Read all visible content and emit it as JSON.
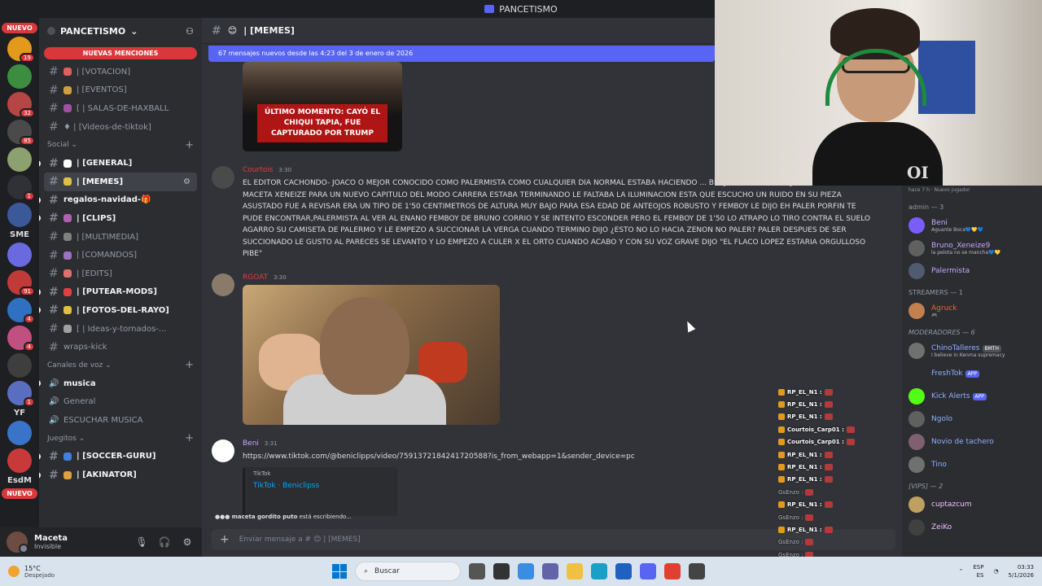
{
  "window": {
    "title": "PANCETISMO"
  },
  "rail": {
    "nuevo_top": "NUEVO",
    "nuevo_bottom": "NUEVO",
    "servers": [
      {
        "color": "#e39a1c",
        "badge": "19"
      },
      {
        "color": "#3c8d40",
        "badge": ""
      },
      {
        "color": "#b64545",
        "badge": "32"
      },
      {
        "color": "#4a4a4a",
        "badge": "85"
      },
      {
        "color": "#8da070",
        "badge": ""
      },
      {
        "color": "#2f3136",
        "badge": "1"
      },
      {
        "color": "#3b5998",
        "badge": ""
      }
    ],
    "text_sme": "SME",
    "servers2": [
      {
        "color": "#6a6ae0",
        "badge": ""
      },
      {
        "color": "#c03a3a",
        "badge": "91"
      },
      {
        "color": "#3070c0",
        "badge": "4"
      },
      {
        "color": "#c05080",
        "badge": "4"
      },
      {
        "color": "#3e3e3e",
        "badge": ""
      },
      {
        "color": "#5a6ec0",
        "badge": "1"
      }
    ],
    "text_yf": "YF",
    "servers3": [
      {
        "color": "#3a74c8",
        "badge": ""
      },
      {
        "color": "#c83a3a",
        "badge": ""
      }
    ],
    "text_esdm": "EsdM"
  },
  "guild": {
    "name": "PANCETISMO",
    "mentions_label": "NUEVAS MENCIONES"
  },
  "channels_top": [
    {
      "name": "| [VOTACION]",
      "emo": "#e06060"
    },
    {
      "name": "| [EVENTOS]",
      "emo": "#d0a040"
    },
    {
      "name": "[ | SALAS-DE-HAXBALL",
      "emo": "#a050a0"
    },
    {
      "name": "♦ | [Videos-de-tiktok]",
      "emo": ""
    }
  ],
  "cat_social": "Social",
  "channels_social": [
    {
      "name": "| [GENERAL]",
      "emo": "#ffffff",
      "bold": true
    },
    {
      "name": "| [MEMES]",
      "emo": "#e0c040",
      "bold": true,
      "active": true
    },
    {
      "name": "regalos-navidad-🎁",
      "emo": "",
      "bold": true
    },
    {
      "name": "| [CLIPS]",
      "emo": "#b060b0",
      "bold": true
    },
    {
      "name": "| [MULTIMEDIA]",
      "emo": "#808080",
      "bold": false
    },
    {
      "name": "| [COMANDOS]",
      "emo": "#a070c0",
      "bold": false
    },
    {
      "name": "| [EDITS]",
      "emo": "#e07070",
      "bold": false
    },
    {
      "name": "| [PUTEAR-MODS]",
      "emo": "#e04040",
      "bold": true
    },
    {
      "name": "| [FOTOS-DEL-RAYO]",
      "emo": "#e0c040",
      "bold": true
    },
    {
      "name": "[ | Ideas-y-tornados-...",
      "emo": "#a0a0a0",
      "bold": false
    },
    {
      "name": "wraps-kick",
      "emo": "",
      "bold": false
    }
  ],
  "cat_voice": "Canales de voz",
  "channels_voice": [
    {
      "name": "musica",
      "bold": true
    },
    {
      "name": "General",
      "bold": false
    },
    {
      "name": "ESCUCHAR MUSICA",
      "bold": false
    }
  ],
  "cat_games": "Juegitos",
  "channels_games": [
    {
      "name": "| [SOCCER-GURU]",
      "emo": "#4080e0",
      "bold": true
    },
    {
      "name": "| [AKINATOR]",
      "emo": "#e0a040",
      "bold": true
    }
  ],
  "user": {
    "name": "Maceta",
    "status": "Invisible"
  },
  "chat": {
    "channel_name": "| [MEMES]",
    "new_messages": "67 mensajes nuevos desde las 4:23 del 3 de enero de 2026",
    "image1_caption": "ÚLTIMO MOMENTO: CAYÓ EL CHIQUI TAPIA, FUE CAPTURADO POR TRUMP",
    "msg1": {
      "author": "Courtois",
      "author_color": "#e03c3c",
      "time": "3:30",
      "text": "EL EDITOR CACHONDO- JOACO O MEJOR CONOCIDO COMO PALERMISTA COMO CUALQUIER DIA NORMAL ESTABA HACIENDO ... BENJAMIN TORRES MEJOR CONOCIDO COMO MACETA XENEIZE PARA UN NUEVO CAPITULO DEL MODO CARRERA ESTABA TERMINANDO LE FALTABA LA ILUMINACION ESTA QUE ESCUCHO UN RUIDO EN SU PIEZA ASUSTADO FUE A REVISAR ERA UN TIPO DE 1'50 CENTIMETROS DE ALTURA MUY BAJO PARA ESA EDAD DE ANTEOJOS ROBUSTO Y FEMBOY LE DIJO EH PALER PORFIN TE PUDE ENCONTRAR,PALERMISTA AL VER AL ENANO FEMBOY DE BRUNO CORRIO Y SE INTENTO ESCONDER PERO EL FEMBOY DE 1'50 LO ATRAPO LO TIRO CONTRA EL SUELO AGARRO SU CAMISETA DE PALERMO Y LE EMPEZO A SUCCIONAR LA VERGA CUANDO TERMINO DIJO ¿ESTO NO LO HACIA ZENON NO PALER? PALER DESPUES DE SER SUCCIONADO LE GUSTO AL PARECES SE LEVANTO Y LO EMPEZO A CULER X EL ORTO CUANDO ACABO Y CON SU VOZ GRAVE DIJO \"EL FLACO LOPEZ ESTARIA ORGULLOSO PIBE\""
    },
    "msg2": {
      "author": "RGOAT",
      "author_color": "#e03c3c",
      "time": "3:30"
    },
    "msg3": {
      "author": "Beni",
      "author_color": "#c9a7ff",
      "time": "3:31",
      "link": "https://www.tiktok.com/@beniclipps/video/7591372184241720588?is_from_webapp=1&sender_device=pc",
      "embed_provider": "TikTok",
      "embed_title": "TikTok · Beniclipss"
    },
    "typing_user": "maceta gordito puto",
    "typing_text": " está escribiendo...",
    "input_placeholder": "Enviar mensaje a #",
    "input_channel": "| [MEMES]"
  },
  "members": {
    "top_strip": "hace 7 h  ·  Nuevo jugador",
    "group_admin": "admin — 3",
    "admins": [
      {
        "name": "Beni",
        "sub": "Aguante Boca💙💛💙",
        "color": "#c9a7ff",
        "av": "#7a5cff"
      },
      {
        "name": "Bruno_Xeneize9",
        "sub": "la pelota no se mancha💙💛",
        "color": "#c9a7ff",
        "av": "#606060"
      },
      {
        "name": "Palermista",
        "sub": "",
        "color": "#c9a7ff",
        "av": "#505a70"
      }
    ],
    "group_streamers": "STREAMERS — 1",
    "streamers": [
      {
        "name": "Agruck",
        "sub": "🎮",
        "color": "#f06040",
        "av": "#c08050"
      }
    ],
    "group_mods": "MODERADORES — 6",
    "mods": [
      {
        "name": "ChinoTalleres",
        "tag": "BMTH",
        "sub": "I believe in Kenma supremacy",
        "color": "#8fb0ff",
        "av": "#707070"
      },
      {
        "name": "FreshTok",
        "app": "APP",
        "color": "#8fb0ff",
        "av": "#2b2d31"
      },
      {
        "name": "Kick Alerts",
        "app": "APP",
        "color": "#8fb0ff",
        "av": "#53fc18"
      },
      {
        "name": "Ngolo",
        "color": "#8fb0ff",
        "av": "#606060"
      },
      {
        "name": "Novio de tachero",
        "color": "#8fb0ff",
        "av": "#806070"
      },
      {
        "name": "Tino",
        "color": "#8fb0ff",
        "av": "#707070"
      }
    ],
    "group_vips": "[VIPS] — 2",
    "vips": [
      {
        "name": "cuptazcum",
        "color": "#f0c0ff",
        "av": "#c0a060"
      },
      {
        "name": "ZeiKo",
        "color": "#f0c0ff",
        "av": "#404040"
      }
    ]
  },
  "overlay_chat": [
    {
      "user": "RP_EL_N1 :",
      "dim": false
    },
    {
      "user": "RP_EL_N1 :",
      "dim": false
    },
    {
      "user": "RP_EL_N1 :",
      "dim": false
    },
    {
      "user": "Courtois_Carp01 :",
      "dim": false
    },
    {
      "user": "Courtois_Carp01 :",
      "dim": false
    },
    {
      "user": "RP_EL_N1 :",
      "dim": false
    },
    {
      "user": "RP_EL_N1 :",
      "dim": false
    },
    {
      "user": "RP_EL_N1 :",
      "dim": false
    },
    {
      "user": "GsEnzo :",
      "dim": true
    },
    {
      "user": "RP_EL_N1 :",
      "dim": false
    },
    {
      "user": "GsEnzo :",
      "dim": true
    },
    {
      "user": "RP_EL_N1 :",
      "dim": false
    },
    {
      "user": "GsEnzo :",
      "dim": true
    },
    {
      "user": "GsEnzo :",
      "dim": true
    }
  ],
  "cam_logo": "OI",
  "taskbar": {
    "temp": "15°C",
    "weather": "Despejado",
    "search": "Buscar",
    "lang": "ESP",
    "lang2": "ES",
    "time": "03:33",
    "date": "5/1/2026"
  }
}
